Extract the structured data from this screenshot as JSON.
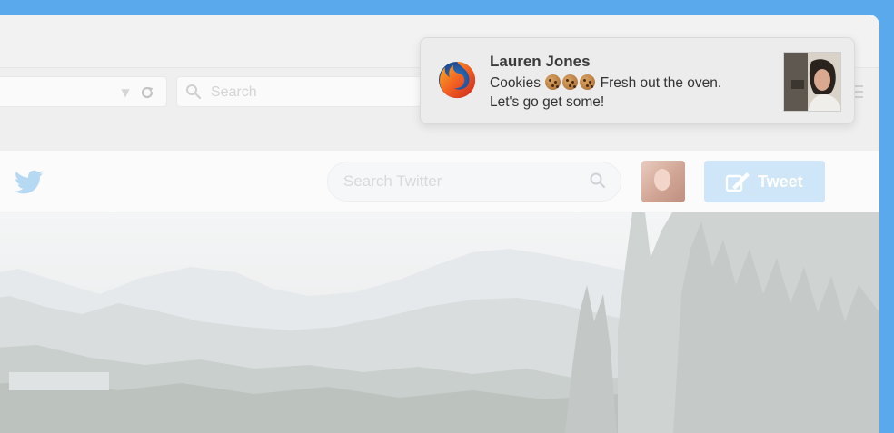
{
  "browser": {
    "search_placeholder": "Search",
    "url_value": ""
  },
  "twitter": {
    "search_placeholder": "Search Twitter",
    "tweet_button_label": "Tweet",
    "brand_color": "#1da1f2"
  },
  "notification": {
    "app_icon": "firefox-icon",
    "title": "Lauren Jones",
    "body_prefix": "Cookies",
    "body_emoji": [
      "cookie",
      "cookie",
      "cookie"
    ],
    "body_suffix": " Fresh out the oven.",
    "body_line2": "Let's go get some!",
    "image": "sender-photo"
  },
  "colors": {
    "desktop": "#5aa9ec",
    "notification_bg": "#ececec",
    "tweet_button": "#cfe5f8"
  }
}
